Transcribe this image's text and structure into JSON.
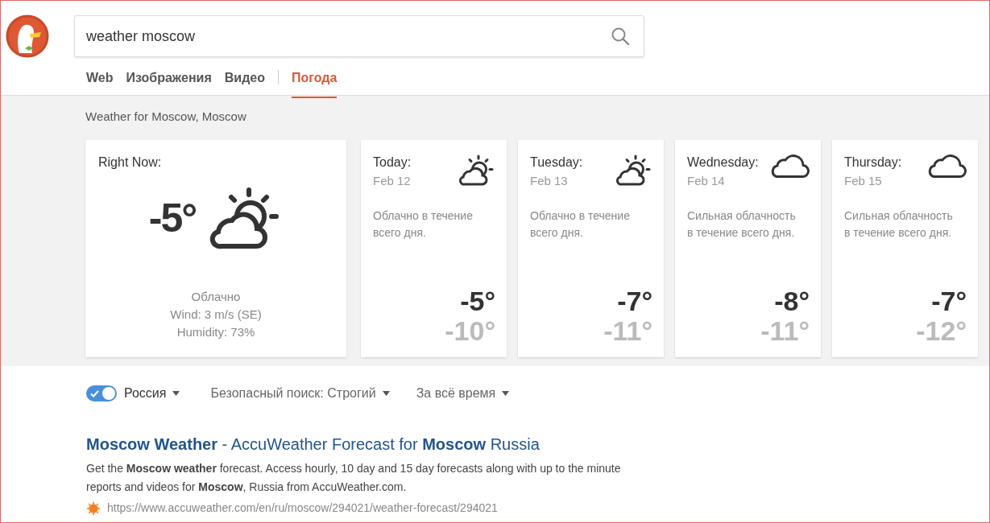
{
  "search": {
    "value": "weather moscow"
  },
  "tabs": [
    {
      "label": "Web",
      "selected": false
    },
    {
      "label": "Изображения",
      "selected": false
    },
    {
      "label": "Видео",
      "selected": false
    },
    {
      "label": "Погода",
      "selected": true
    }
  ],
  "weather": {
    "heading": "Weather for Moscow, Moscow",
    "now": {
      "label": "Right Now:",
      "temp": "-5°",
      "kind": "partly-cloudy",
      "condition": "Облачно",
      "wind": "Wind: 3 m/s (SE)",
      "humidity": "Humidity: 73%"
    },
    "days": [
      {
        "day": "Today:",
        "date": "Feb 12",
        "kind": "partly-cloudy",
        "summary": "Облачно в течение всего дня.",
        "high": "-5°",
        "low": "-10°"
      },
      {
        "day": "Tuesday:",
        "date": "Feb 13",
        "kind": "partly-cloudy",
        "summary": "Облачно в течение всего дня.",
        "high": "-7°",
        "low": "-11°"
      },
      {
        "day": "Wednesday:",
        "date": "Feb 14",
        "kind": "cloudy",
        "summary": "Сильная облачность в течение всего дня.",
        "high": "-8°",
        "low": "-11°"
      },
      {
        "day": "Thursday:",
        "date": "Feb 15",
        "kind": "cloudy",
        "summary": "Сильная облачность в течение всего дня.",
        "high": "-7°",
        "low": "-12°"
      }
    ]
  },
  "filters": {
    "region": {
      "label": "Россия",
      "on": true
    },
    "safe_search": "Безопасный поиск: Строгий",
    "time": "За всё время"
  },
  "results": [
    {
      "title": "**Moscow Weather** - AccuWeather Forecast for **Moscow** Russia",
      "snippet": "Get the **Moscow weather** forecast. Access hourly, 10 day and 15 day forecasts along with up to the minute reports and videos for **Moscow**, Russia from AccuWeather.com.",
      "url": "https://www.accuweather.com/en/ru/moscow/294021/weather-forecast/294021"
    }
  ]
}
